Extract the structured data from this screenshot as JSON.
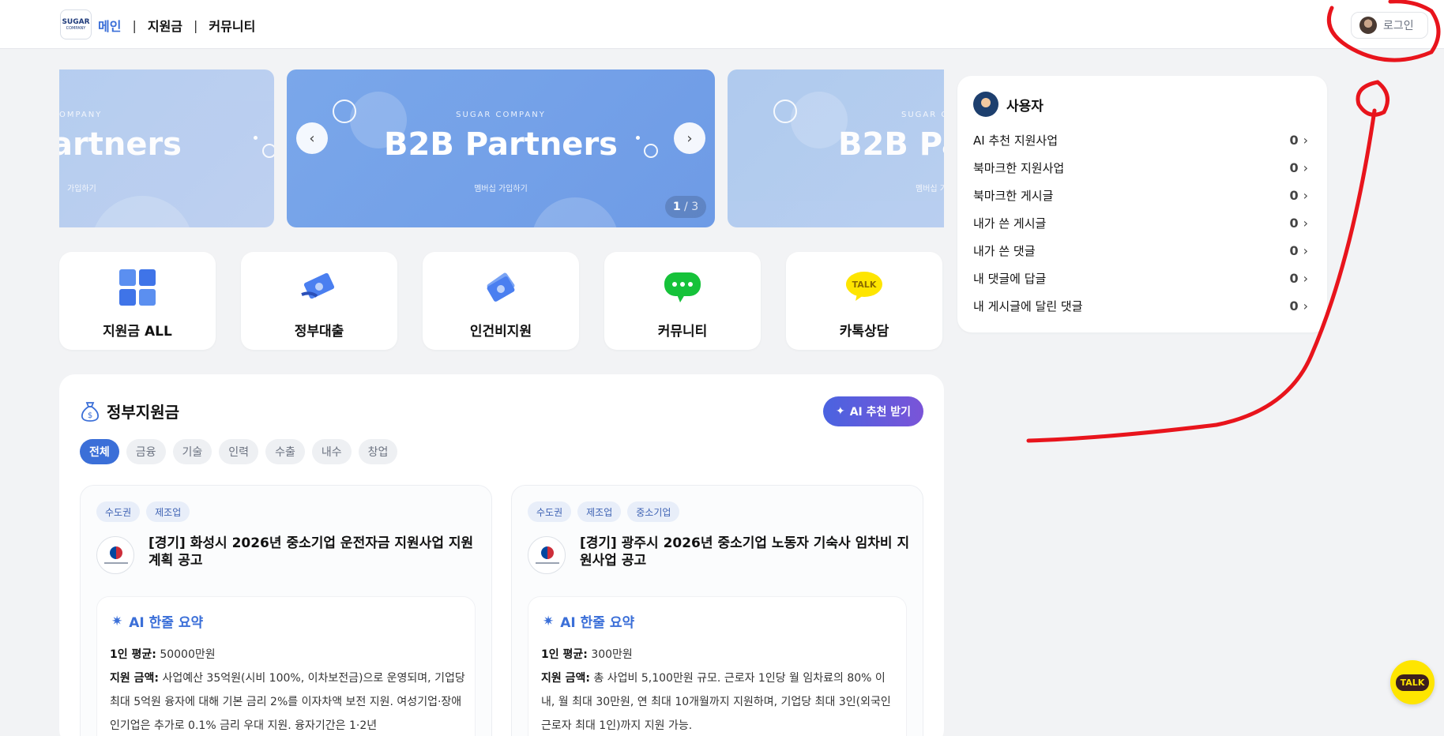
{
  "header": {
    "logo_line1": "SUGAR",
    "logo_line2": "COMPANY",
    "nav": [
      "메인",
      "지원금",
      "커뮤니티"
    ],
    "login_label": "로그인"
  },
  "carousel": {
    "company": "SUGAR COMPANY",
    "title": "B2B Partners",
    "subtitle": "멤버십 가입하기",
    "left_title": "artners",
    "left_company": "OMPANY",
    "left_sub": "가입하기",
    "right_title": "B2B Pa",
    "right_company": "SUGAR CO",
    "right_sub": "멤버십 가입하",
    "page_current": "1",
    "page_total": "3"
  },
  "quick_menu": [
    {
      "label": "지원금 ALL",
      "icon": "grid-icon"
    },
    {
      "label": "정부대출",
      "icon": "money-icon"
    },
    {
      "label": "인건비지원",
      "icon": "money-stack-icon"
    },
    {
      "label": "커뮤니티",
      "icon": "chat-bubble-icon"
    },
    {
      "label": "카톡상담",
      "icon": "talk-icon"
    }
  ],
  "user_panel": {
    "title": "사용자",
    "items": [
      {
        "label": "AI 추천 지원사업",
        "count": "0"
      },
      {
        "label": "북마크한 지원사업",
        "count": "0"
      },
      {
        "label": "북마크한 게시글",
        "count": "0"
      },
      {
        "label": "내가 쓴 게시글",
        "count": "0"
      },
      {
        "label": "내가 쓴 댓글",
        "count": "0"
      },
      {
        "label": "내 댓글에 답글",
        "count": "0"
      },
      {
        "label": "내 게시글에 달린 댓글",
        "count": "0"
      }
    ]
  },
  "gov": {
    "title": "정부지원금",
    "ai_button": "AI 추천 받기",
    "chips": [
      "전체",
      "금융",
      "기술",
      "인력",
      "수출",
      "내수",
      "창업"
    ],
    "cards": [
      {
        "tags": [
          "수도권",
          "제조업"
        ],
        "title": "[경기] 화성시 2026년 중소기업 운전자금 지원사업 지원계획 공고",
        "summary_title": "AI 한줄 요약",
        "avg_label": "1인 평균:",
        "avg_value": "50000만원",
        "amount_label": "지원 금액:",
        "amount_text": "사업예산 35억원(시비 100%, 이차보전금)으로 운영되며, 기업당 최대 5억원 융자에 대해 기본 금리 2%를 이자차액 보전 지원. 여성기업·장애인기업은 추가로 0.1% 금리 우대 지원. 융자기간은 1·2년"
      },
      {
        "tags": [
          "수도권",
          "제조업",
          "중소기업"
        ],
        "title": "[경기] 광주시 2026년 중소기업 노동자 기숙사 임차비 지원사업 공고",
        "summary_title": "AI 한줄 요약",
        "avg_label": "1인 평균:",
        "avg_value": "300만원",
        "amount_label": "지원 금액:",
        "amount_text": "총 사업비 5,100만원 규모. 근로자 1인당 월 임차료의 80% 이내, 월 최대 30만원, 연 최대 10개월까지 지원하며, 기업당 최대 3인(외국인 근로자 최대 1인)까지 지원 가능."
      }
    ]
  },
  "fab_label": "TALK"
}
